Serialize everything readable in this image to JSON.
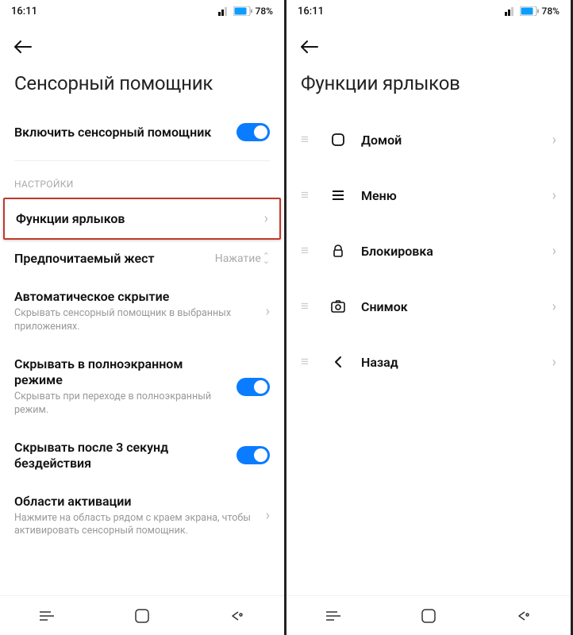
{
  "status": {
    "time": "16:11",
    "battery": "78%"
  },
  "left": {
    "title": "Сенсорный помощник",
    "enable": {
      "label": "Включить сенсорный помощник",
      "on": true
    },
    "section_label": "НАСТРОЙКИ",
    "shortcut_functions": {
      "label": "Функции ярлыков"
    },
    "gesture": {
      "label": "Предпочитаемый жест",
      "value": "Нажатие"
    },
    "auto_hide": {
      "label": "Автоматическое скрытие",
      "sub": "Скрывать сенсорный помощник в выбранных приложениях."
    },
    "fullscreen_hide": {
      "label": "Скрывать в полноэкранном режиме",
      "sub": "Скрывать при переходе в полноэкранный режим.",
      "on": true
    },
    "idle_hide": {
      "label": "Скрывать после 3 секунд бездействия",
      "on": true
    },
    "activation": {
      "label": "Области активации",
      "sub": "Нажмите на область рядом с краем экрана, чтобы активировать сенсорный помощник."
    }
  },
  "right": {
    "title": "Функции ярлыков",
    "items": [
      {
        "icon": "home",
        "label": "Домой"
      },
      {
        "icon": "menu",
        "label": "Меню"
      },
      {
        "icon": "lock",
        "label": "Блокировка"
      },
      {
        "icon": "screenshot",
        "label": "Снимок"
      },
      {
        "icon": "back",
        "label": "Назад"
      }
    ]
  }
}
